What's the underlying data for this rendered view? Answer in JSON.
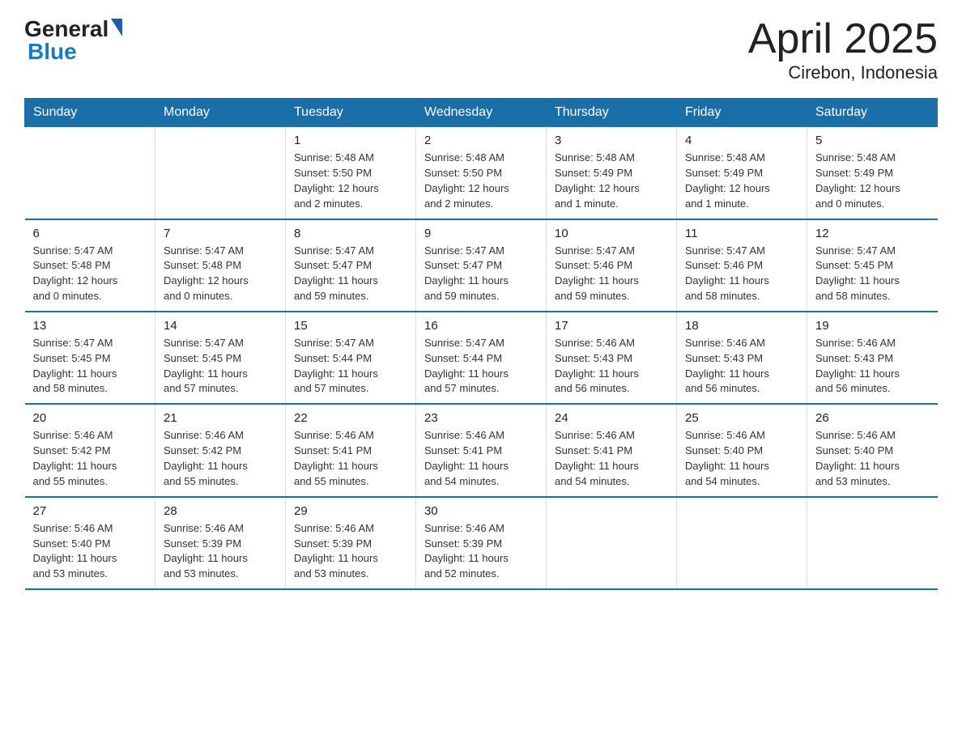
{
  "header": {
    "logo_general": "General",
    "logo_blue": "Blue",
    "title": "April 2025",
    "subtitle": "Cirebon, Indonesia"
  },
  "days_of_week": [
    "Sunday",
    "Monday",
    "Tuesday",
    "Wednesday",
    "Thursday",
    "Friday",
    "Saturday"
  ],
  "weeks": [
    [
      {
        "day": "",
        "info": ""
      },
      {
        "day": "",
        "info": ""
      },
      {
        "day": "1",
        "info": "Sunrise: 5:48 AM\nSunset: 5:50 PM\nDaylight: 12 hours\nand 2 minutes."
      },
      {
        "day": "2",
        "info": "Sunrise: 5:48 AM\nSunset: 5:50 PM\nDaylight: 12 hours\nand 2 minutes."
      },
      {
        "day": "3",
        "info": "Sunrise: 5:48 AM\nSunset: 5:49 PM\nDaylight: 12 hours\nand 1 minute."
      },
      {
        "day": "4",
        "info": "Sunrise: 5:48 AM\nSunset: 5:49 PM\nDaylight: 12 hours\nand 1 minute."
      },
      {
        "day": "5",
        "info": "Sunrise: 5:48 AM\nSunset: 5:49 PM\nDaylight: 12 hours\nand 0 minutes."
      }
    ],
    [
      {
        "day": "6",
        "info": "Sunrise: 5:47 AM\nSunset: 5:48 PM\nDaylight: 12 hours\nand 0 minutes."
      },
      {
        "day": "7",
        "info": "Sunrise: 5:47 AM\nSunset: 5:48 PM\nDaylight: 12 hours\nand 0 minutes."
      },
      {
        "day": "8",
        "info": "Sunrise: 5:47 AM\nSunset: 5:47 PM\nDaylight: 11 hours\nand 59 minutes."
      },
      {
        "day": "9",
        "info": "Sunrise: 5:47 AM\nSunset: 5:47 PM\nDaylight: 11 hours\nand 59 minutes."
      },
      {
        "day": "10",
        "info": "Sunrise: 5:47 AM\nSunset: 5:46 PM\nDaylight: 11 hours\nand 59 minutes."
      },
      {
        "day": "11",
        "info": "Sunrise: 5:47 AM\nSunset: 5:46 PM\nDaylight: 11 hours\nand 58 minutes."
      },
      {
        "day": "12",
        "info": "Sunrise: 5:47 AM\nSunset: 5:45 PM\nDaylight: 11 hours\nand 58 minutes."
      }
    ],
    [
      {
        "day": "13",
        "info": "Sunrise: 5:47 AM\nSunset: 5:45 PM\nDaylight: 11 hours\nand 58 minutes."
      },
      {
        "day": "14",
        "info": "Sunrise: 5:47 AM\nSunset: 5:45 PM\nDaylight: 11 hours\nand 57 minutes."
      },
      {
        "day": "15",
        "info": "Sunrise: 5:47 AM\nSunset: 5:44 PM\nDaylight: 11 hours\nand 57 minutes."
      },
      {
        "day": "16",
        "info": "Sunrise: 5:47 AM\nSunset: 5:44 PM\nDaylight: 11 hours\nand 57 minutes."
      },
      {
        "day": "17",
        "info": "Sunrise: 5:46 AM\nSunset: 5:43 PM\nDaylight: 11 hours\nand 56 minutes."
      },
      {
        "day": "18",
        "info": "Sunrise: 5:46 AM\nSunset: 5:43 PM\nDaylight: 11 hours\nand 56 minutes."
      },
      {
        "day": "19",
        "info": "Sunrise: 5:46 AM\nSunset: 5:43 PM\nDaylight: 11 hours\nand 56 minutes."
      }
    ],
    [
      {
        "day": "20",
        "info": "Sunrise: 5:46 AM\nSunset: 5:42 PM\nDaylight: 11 hours\nand 55 minutes."
      },
      {
        "day": "21",
        "info": "Sunrise: 5:46 AM\nSunset: 5:42 PM\nDaylight: 11 hours\nand 55 minutes."
      },
      {
        "day": "22",
        "info": "Sunrise: 5:46 AM\nSunset: 5:41 PM\nDaylight: 11 hours\nand 55 minutes."
      },
      {
        "day": "23",
        "info": "Sunrise: 5:46 AM\nSunset: 5:41 PM\nDaylight: 11 hours\nand 54 minutes."
      },
      {
        "day": "24",
        "info": "Sunrise: 5:46 AM\nSunset: 5:41 PM\nDaylight: 11 hours\nand 54 minutes."
      },
      {
        "day": "25",
        "info": "Sunrise: 5:46 AM\nSunset: 5:40 PM\nDaylight: 11 hours\nand 54 minutes."
      },
      {
        "day": "26",
        "info": "Sunrise: 5:46 AM\nSunset: 5:40 PM\nDaylight: 11 hours\nand 53 minutes."
      }
    ],
    [
      {
        "day": "27",
        "info": "Sunrise: 5:46 AM\nSunset: 5:40 PM\nDaylight: 11 hours\nand 53 minutes."
      },
      {
        "day": "28",
        "info": "Sunrise: 5:46 AM\nSunset: 5:39 PM\nDaylight: 11 hours\nand 53 minutes."
      },
      {
        "day": "29",
        "info": "Sunrise: 5:46 AM\nSunset: 5:39 PM\nDaylight: 11 hours\nand 53 minutes."
      },
      {
        "day": "30",
        "info": "Sunrise: 5:46 AM\nSunset: 5:39 PM\nDaylight: 11 hours\nand 52 minutes."
      },
      {
        "day": "",
        "info": ""
      },
      {
        "day": "",
        "info": ""
      },
      {
        "day": "",
        "info": ""
      }
    ]
  ]
}
